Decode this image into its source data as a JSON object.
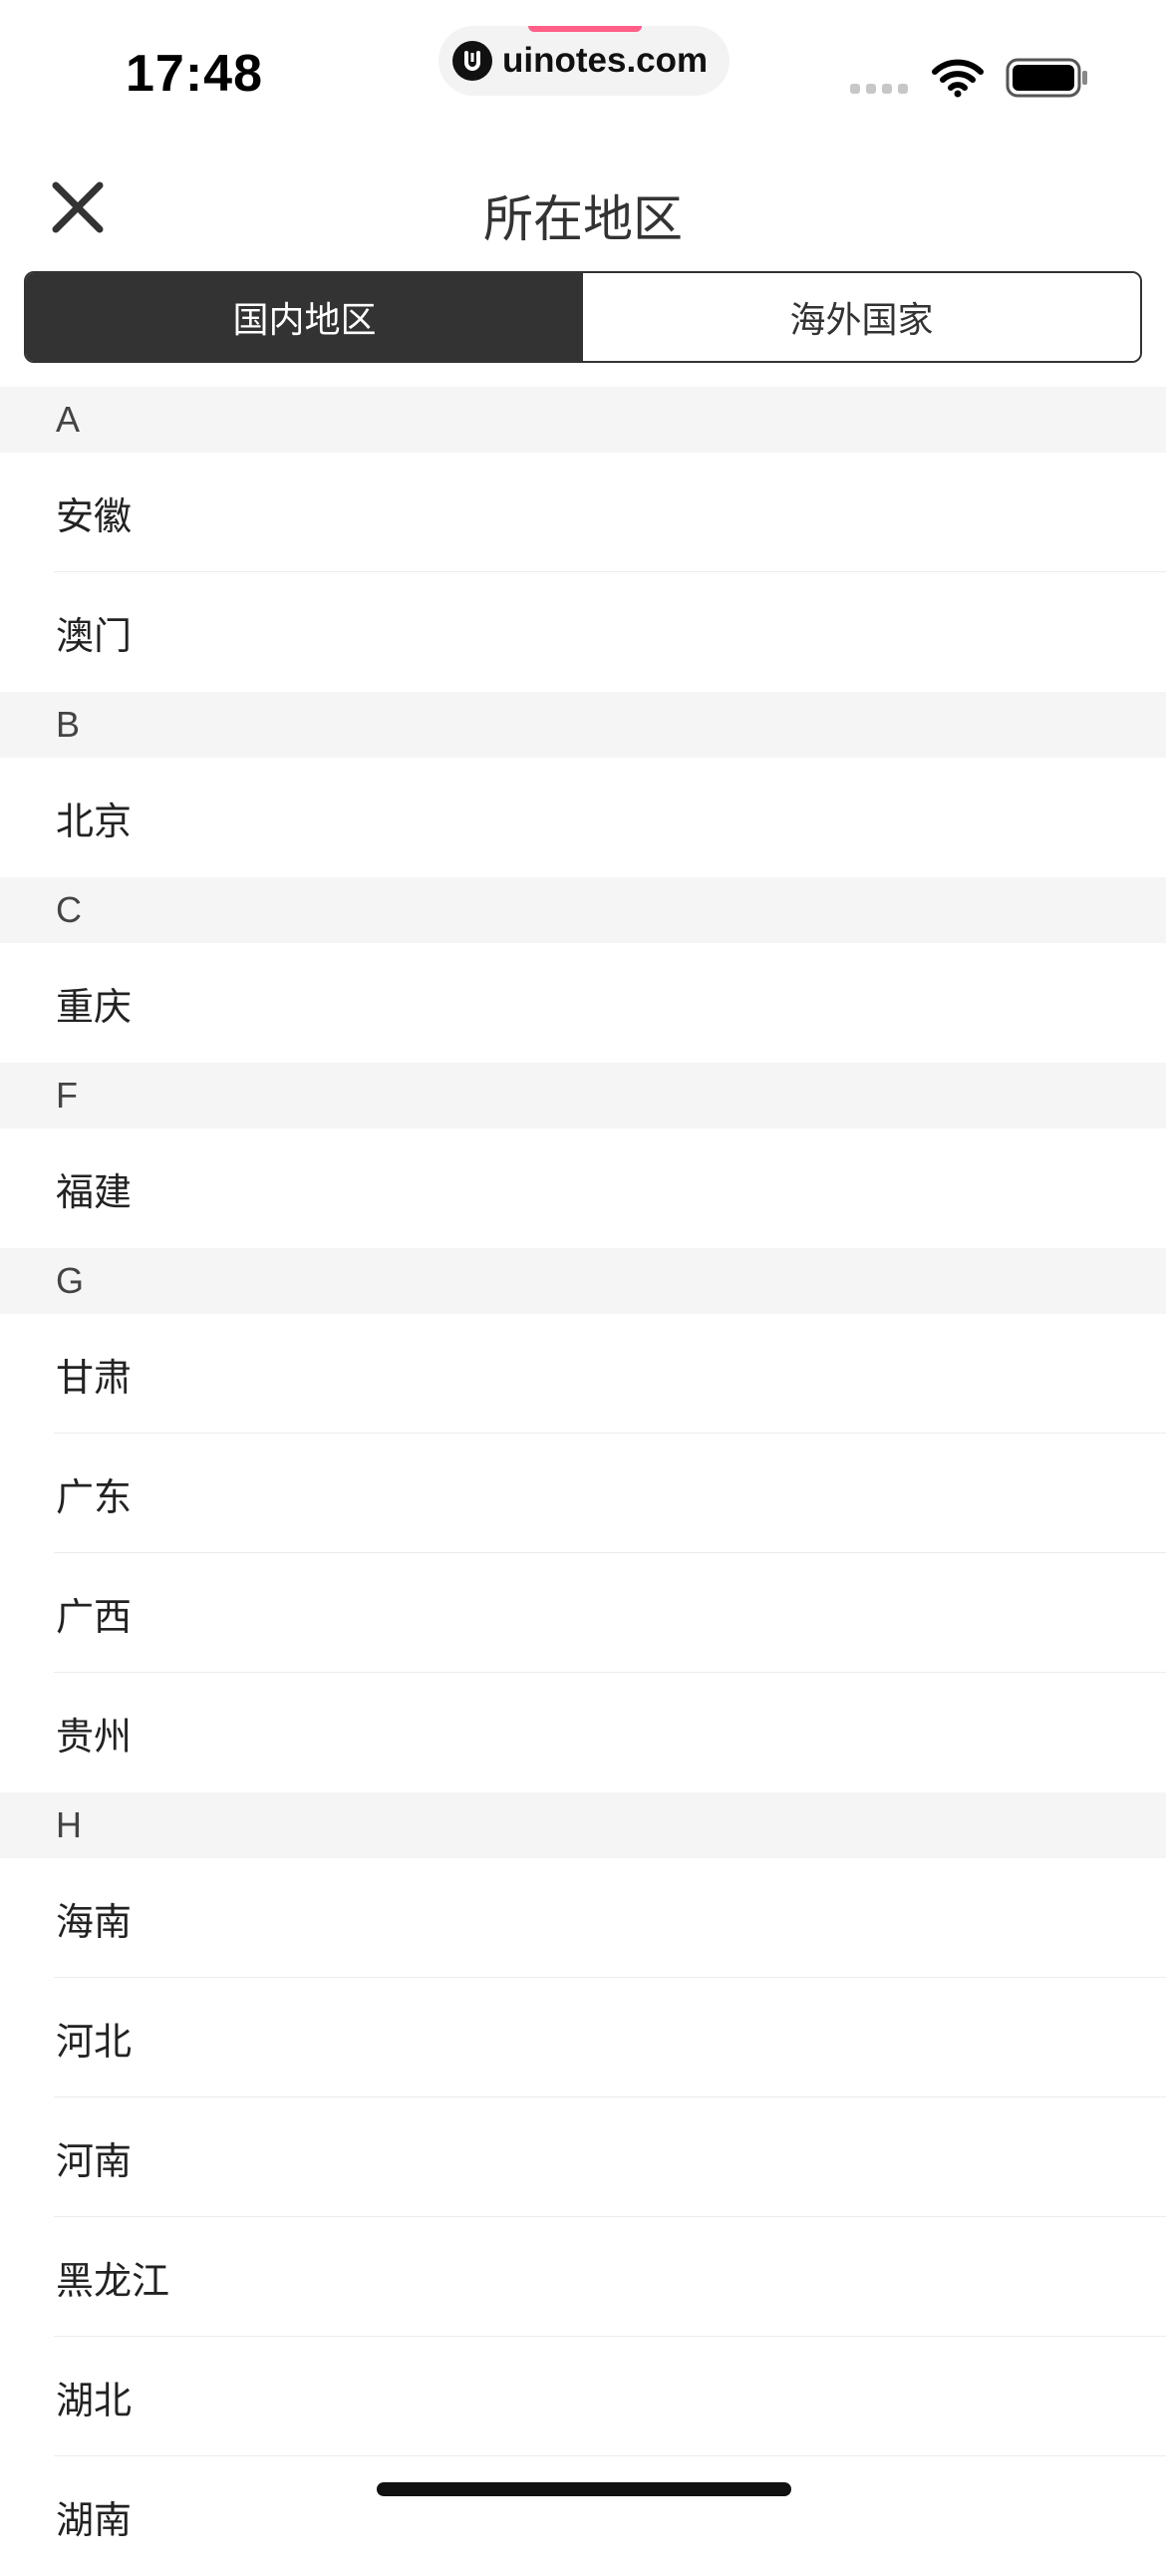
{
  "status_bar": {
    "time": "17:48",
    "url": "uinotes.com",
    "icons": [
      "signal-dots-icon",
      "wifi-icon",
      "battery-icon"
    ]
  },
  "header": {
    "title": "所在地区",
    "close_icon": "close-icon"
  },
  "segmented": {
    "tabs": [
      {
        "label": "国内地区",
        "active": true
      },
      {
        "label": "海外国家",
        "active": false
      }
    ]
  },
  "sections": [
    {
      "letter": "A",
      "items": [
        "安徽",
        "澳门"
      ]
    },
    {
      "letter": "B",
      "items": [
        "北京"
      ]
    },
    {
      "letter": "C",
      "items": [
        "重庆"
      ]
    },
    {
      "letter": "F",
      "items": [
        "福建"
      ]
    },
    {
      "letter": "G",
      "items": [
        "甘肃",
        "广东",
        "广西",
        "贵州"
      ]
    },
    {
      "letter": "H",
      "items": [
        "海南",
        "河北",
        "河南",
        "黑龙江",
        "湖北",
        "湖南"
      ]
    }
  ],
  "colors": {
    "active_segment_bg": "#333333",
    "section_header_bg": "#f5f5f5",
    "url_accent": "#ff5f87"
  }
}
